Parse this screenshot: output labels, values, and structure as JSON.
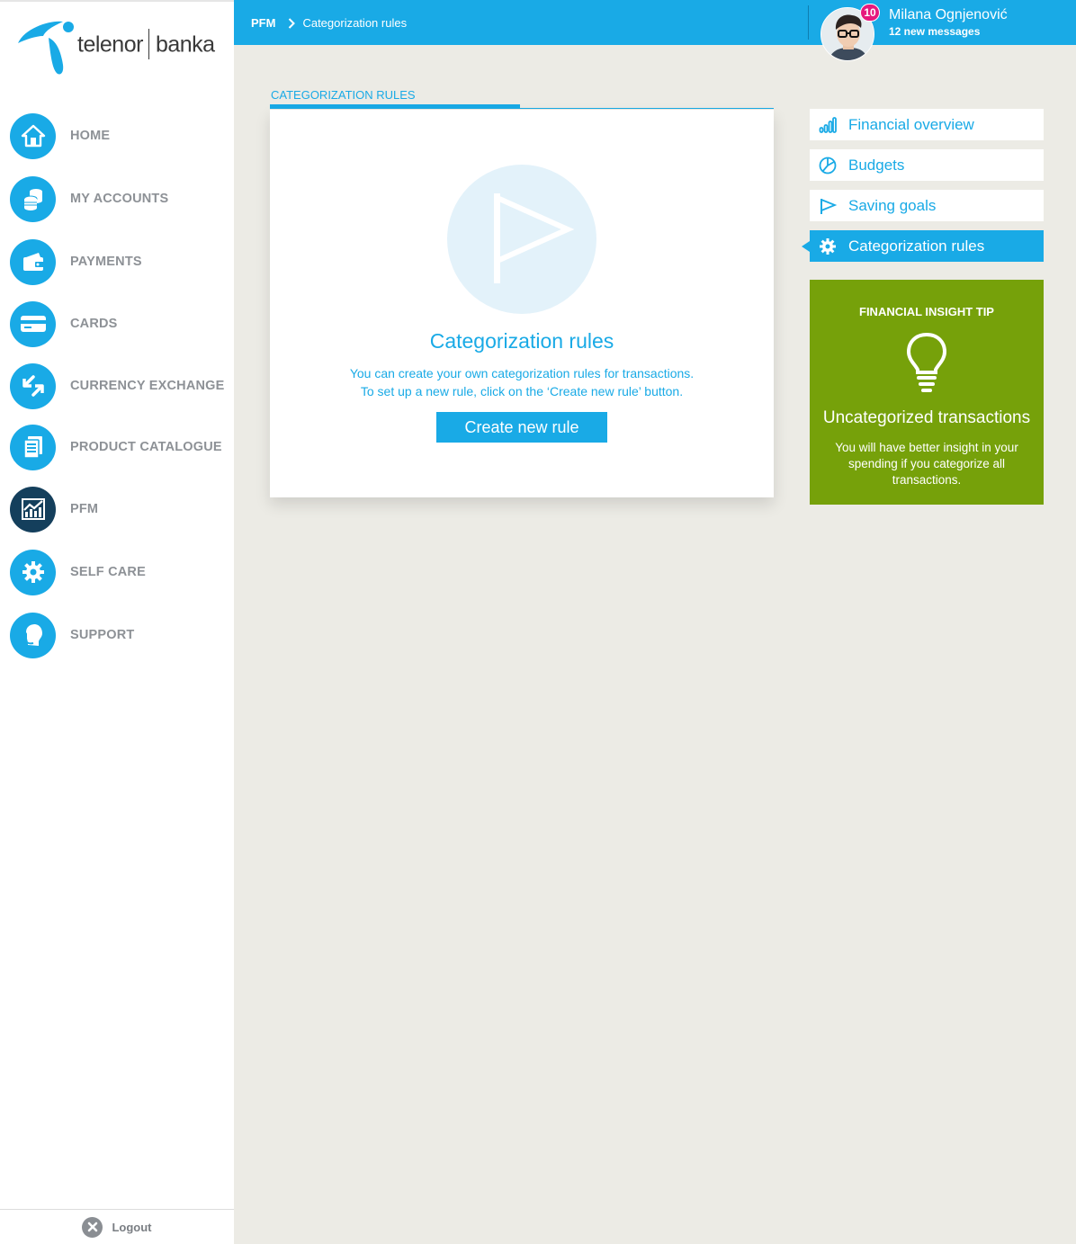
{
  "brand": {
    "logo_left": "telenor",
    "logo_right": "banka"
  },
  "sidebar": {
    "items": [
      {
        "label": "HOME",
        "icon": "home-icon"
      },
      {
        "label": "MY ACCOUNTS",
        "icon": "coins-icon"
      },
      {
        "label": "PAYMENTS",
        "icon": "wallet-icon"
      },
      {
        "label": "CARDS",
        "icon": "card-icon"
      },
      {
        "label": "CURRENCY EXCHANGE",
        "icon": "exchange-icon"
      },
      {
        "label": "PRODUCT CATALOGUE",
        "icon": "catalogue-icon"
      },
      {
        "label": "PFM",
        "icon": "chart-icon",
        "active": true
      },
      {
        "label": "SELF CARE",
        "icon": "gear-icon"
      },
      {
        "label": "SUPPORT",
        "icon": "headset-icon"
      }
    ],
    "logout": "Logout"
  },
  "header": {
    "breadcrumb": [
      "PFM",
      "Categorization rules"
    ],
    "user": {
      "name": "Milana Ognjenović",
      "messages": "12 new messages",
      "badge": "10"
    }
  },
  "main": {
    "tab_label": "CATEGORIZATION RULES",
    "card": {
      "title": "Categorization rules",
      "description_line1": "You can create your own categorization rules for transactions.",
      "description_line2": "To set up a new rule, click on the ‘Create new rule’ button.",
      "button": "Create new rule"
    }
  },
  "right_menu": {
    "items": [
      {
        "label": "Financial overview",
        "icon": "bar-chart-icon"
      },
      {
        "label": "Budgets",
        "icon": "pie-chart-icon"
      },
      {
        "label": "Saving goals",
        "icon": "flag-icon"
      },
      {
        "label": "Categorization rules",
        "icon": "gear-icon",
        "active": true
      }
    ]
  },
  "tip": {
    "heading": "FINANCIAL INSIGHT TIP",
    "title": "Uncategorized transactions",
    "body": "You will have better insight in your spending if you categorize all transactions."
  },
  "colors": {
    "accent": "#19aae6",
    "nav_active": "#143f5c",
    "tip_bg": "#76a10a",
    "badge": "#e6197d",
    "page_bg": "#ecebe5"
  }
}
